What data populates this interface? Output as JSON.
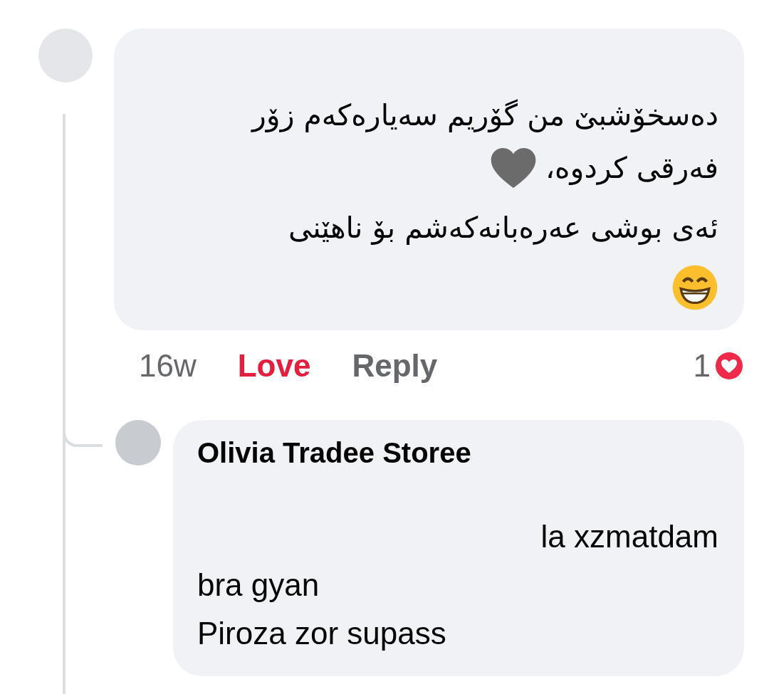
{
  "comment": {
    "lines": [
      {
        "kind": "text",
        "text": "دەسخۆشبێ من گۆریم سەیارەکەم زۆر"
      },
      {
        "kind": "text-heart",
        "text": "فەرقی کردوە،"
      },
      {
        "kind": "text",
        "text": "ئەی بوشی عەرەبانەکەشم بۆ ناهێنی"
      },
      {
        "kind": "grin"
      }
    ],
    "actions": [
      {
        "kind": "time",
        "label": "16w"
      },
      {
        "kind": "react",
        "label": "Love",
        "selected": true
      },
      {
        "kind": "reply",
        "label": "Reply"
      }
    ],
    "reaction_count": "1"
  },
  "reply": {
    "author": "Olivia Tradee Storee",
    "lines": [
      {
        "kind": "right-aligned",
        "text": "la xzmatdam"
      },
      {
        "kind": "plain",
        "text": "bra gyan"
      },
      {
        "kind": "plain",
        "text": "Piroza zor supass"
      }
    ]
  }
}
